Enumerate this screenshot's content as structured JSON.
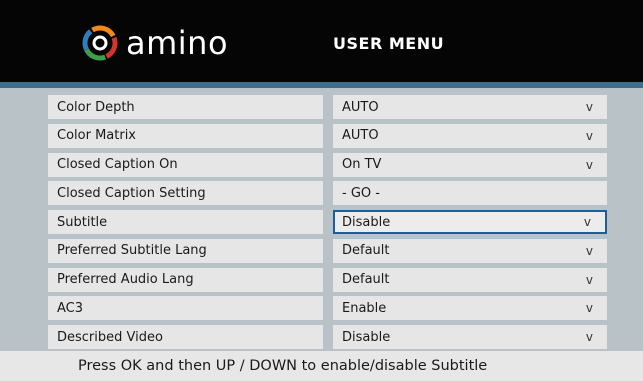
{
  "header": {
    "brand": "amino",
    "menu_title": "USER MENU"
  },
  "rows": [
    {
      "label": "Color Depth",
      "value": "AUTO",
      "arrow": "v",
      "focused": false
    },
    {
      "label": "Color Matrix",
      "value": "AUTO",
      "arrow": "v",
      "focused": false
    },
    {
      "label": "Closed Caption On",
      "value": "On TV",
      "arrow": "v",
      "focused": false
    },
    {
      "label": "Closed Caption Setting",
      "value": "- GO -",
      "arrow": "",
      "focused": false
    },
    {
      "label": "Subtitle",
      "value": "Disable",
      "arrow": "v",
      "focused": true
    },
    {
      "label": "Preferred Subtitle Lang",
      "value": "Default",
      "arrow": "v",
      "focused": false
    },
    {
      "label": "Preferred Audio Lang",
      "value": "Default",
      "arrow": "v",
      "focused": false
    },
    {
      "label": "AC3",
      "value": "Enable",
      "arrow": "v",
      "focused": false
    },
    {
      "label": "Described Video",
      "value": "Disable",
      "arrow": "v",
      "focused": false
    }
  ],
  "footer": {
    "hint": "Press OK and then UP / DOWN to enable/disable Subtitle"
  },
  "colors": {
    "header_bg": "#050505",
    "accent_strip": "#3f6d8c",
    "screen_bg": "#b9c3c7",
    "cell_bg": "#e6e6e6",
    "focus_border": "#1b5e9a",
    "logo_orange": "#f08a1c",
    "logo_red": "#d3342b",
    "logo_blue": "#2e7fc0",
    "logo_green": "#3aa14a"
  }
}
